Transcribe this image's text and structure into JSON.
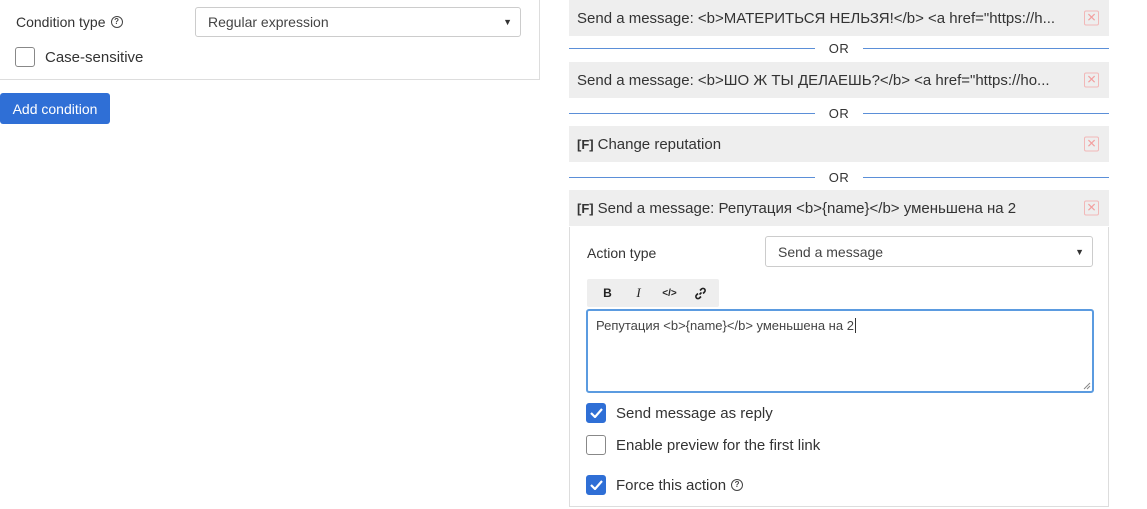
{
  "condition": {
    "type_label": "Condition type",
    "type_value": "Regular expression",
    "case_sensitive_label": "Case-sensitive",
    "case_sensitive_checked": false,
    "add_button": "Add condition"
  },
  "actions": {
    "or_label": "OR",
    "items": [
      {
        "flag": "",
        "text": "Send a message: <b>МАТЕРИТЬСЯ НЕЛЬЗЯ!</b> <a href=\"https://h..."
      },
      {
        "flag": "",
        "text": "Send a message: <b>ШО Ж ТЫ ДЕЛАЕШЬ?</b> <a href=\"https://ho..."
      },
      {
        "flag": "[F]",
        "text": "Change reputation"
      },
      {
        "flag": "[F]",
        "text": "Send a message: Репутация <b>{name}</b> уменьшена на 2"
      }
    ],
    "editor": {
      "action_type_label": "Action type",
      "action_type_value": "Send a message",
      "toolbar": [
        "B",
        "I",
        "</>",
        "link"
      ],
      "message_text": "Репутация <b>{name}</b> уменьшена на 2",
      "send_as_reply_label": "Send message as reply",
      "send_as_reply_checked": true,
      "enable_preview_label": "Enable preview for the first link",
      "enable_preview_checked": false,
      "force_action_label": "Force this action",
      "force_action_checked": true
    }
  },
  "colors": {
    "accent": "#2f6fd6",
    "bar_bg": "#eeeeee",
    "separator": "#5b8fd8",
    "close_icon": "#f2a0a0"
  }
}
